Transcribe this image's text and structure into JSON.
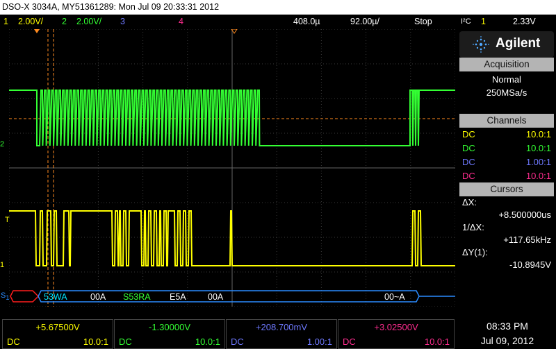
{
  "title": "DSO-X 3034A, MY51361289: Mon Jul 09 20:33:31 2012",
  "status": {
    "ch1_num": "1",
    "ch1_scale": "2.00V/",
    "ch2_num": "2",
    "ch2_scale": "2.00V/",
    "ch3_num": "3",
    "ch4_num": "4",
    "time_delay": "408.0µ",
    "time_scale": "92.00µ/",
    "run_state": "Stop",
    "trigger_type": "I²C",
    "trigger_source": "1",
    "trigger_level": "2.33V"
  },
  "panel": {
    "logo": "Agilent",
    "acquisition": {
      "heading": "Acquisition",
      "mode": "Normal",
      "rate": "250MSa/s"
    },
    "channels": {
      "heading": "Channels",
      "rows": [
        {
          "coupling": "DC",
          "probe": "10.0:1",
          "color": "#ffff00"
        },
        {
          "coupling": "DC",
          "probe": "10.0:1",
          "color": "#33ff33"
        },
        {
          "coupling": "DC",
          "probe": "1.00:1",
          "color": "#6e79ff"
        },
        {
          "coupling": "DC",
          "probe": "10.0:1",
          "color": "#ff2d8f"
        }
      ]
    },
    "cursors": {
      "heading": "Cursors",
      "dx_label": "ΔX:",
      "dx_value": "+8.500000us",
      "inv_dx_label": "1/ΔX:",
      "inv_dx_value": "+117.65kHz",
      "dy_label": "ΔY(1):",
      "dy_value": "-10.8945V"
    }
  },
  "markers": {
    "ch2": "2",
    "trig": "T",
    "ch1": "1",
    "serial": "S",
    "serial_sub": "1"
  },
  "decode": [
    {
      "text": "53WA",
      "color": "#00e5ff"
    },
    {
      "text": "00A",
      "color": "#ffffff"
    },
    {
      "text": "S53RA",
      "color": "#33ff33"
    },
    {
      "text": "E5A",
      "color": "#ffffff"
    },
    {
      "text": "00A",
      "color": "#ffffff"
    },
    {
      "text": "00~A",
      "color": "#ffffff"
    }
  ],
  "bottom": [
    {
      "value": "+5.67500V",
      "coupling": "DC",
      "probe": "10.0:1",
      "color": "#ffff00"
    },
    {
      "value": "-1.30000V",
      "coupling": "DC",
      "probe": "10.0:1",
      "color": "#33ff33"
    },
    {
      "value": "+208.700mV",
      "coupling": "DC",
      "probe": "1.00:1",
      "color": "#6e79ff"
    },
    {
      "value": "+3.02500V",
      "coupling": "DC",
      "probe": "10.0:1",
      "color": "#ff2d8f"
    }
  ],
  "clock": {
    "time": "08:33 PM",
    "date": "Jul 09, 2012"
  },
  "colors": {
    "ch1": "#ffff00",
    "ch2": "#33ff33",
    "ch3": "#6e79ff",
    "ch4": "#ff2d8f",
    "serial": "#2b8cff",
    "cursor": "#ff8a1e"
  }
}
